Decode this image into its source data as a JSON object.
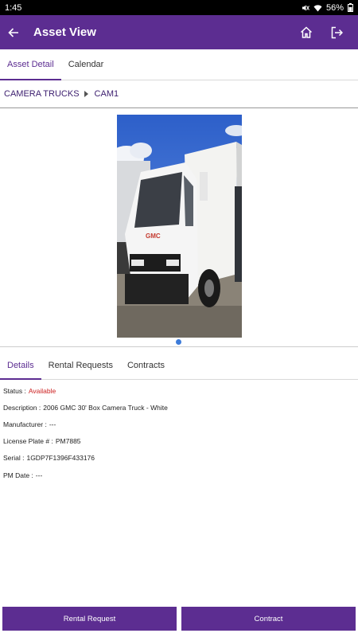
{
  "status_bar": {
    "time": "1:45",
    "battery": "56%",
    "icons": [
      "mute-icon",
      "wifi-icon",
      "battery-icon"
    ]
  },
  "app_bar": {
    "title": "Asset View",
    "icons": [
      "back-arrow-icon",
      "home-icon",
      "logout-icon"
    ]
  },
  "top_tabs": [
    {
      "label": "Asset Detail",
      "active": true
    },
    {
      "label": "Calendar",
      "active": false
    }
  ],
  "breadcrumb": {
    "category": "CAMERA TRUCKS",
    "asset": "CAM1"
  },
  "photo": {
    "alt_icon": "truck-photo",
    "pager_dots": 1,
    "current": 1
  },
  "detail_tabs": [
    {
      "label": "Details",
      "active": true
    },
    {
      "label": "Rental Requests",
      "active": false
    },
    {
      "label": "Contracts",
      "active": false
    }
  ],
  "details": {
    "status_label": "Status :",
    "status_value": "Available",
    "description_label": "Description :",
    "description_value": "2006 GMC 30' Box Camera Truck - White",
    "manufacturer_label": "Manufacturer :",
    "manufacturer_value": "---",
    "license_label": "License Plate # :",
    "license_value": "PM7885",
    "serial_label": "Serial :",
    "serial_value": "1GDP7F1396F433176",
    "pm_date_label": "PM Date :",
    "pm_date_value": "---"
  },
  "buttons": {
    "rental_request": "Rental Request",
    "contract": "Contract"
  },
  "colors": {
    "primary": "#5c2d91",
    "status_available": "#cc1f1f",
    "pager_dot": "#3d7bd9"
  }
}
